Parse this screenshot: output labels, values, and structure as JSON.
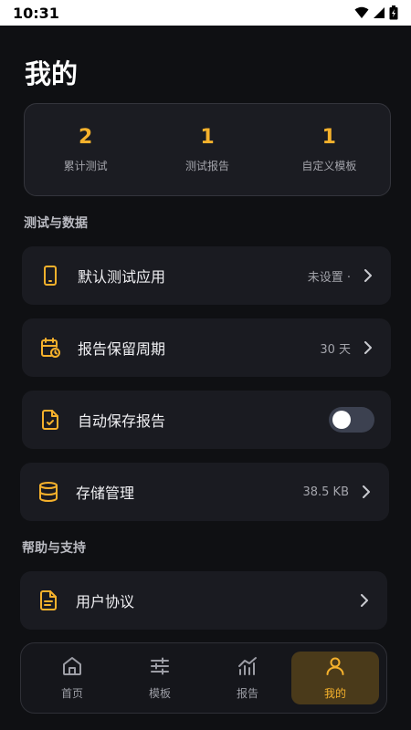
{
  "status_bar": {
    "time": "10:31"
  },
  "page": {
    "title": "我的"
  },
  "stats": [
    {
      "value": "2",
      "label": "累计测试"
    },
    {
      "value": "1",
      "label": "测试报告"
    },
    {
      "value": "1",
      "label": "自定义模板"
    }
  ],
  "sections": {
    "testing_data": "测试与数据",
    "help_support": "帮助与支持"
  },
  "rows": {
    "default_app": {
      "label": "默认测试应用",
      "value": "未设置 ·"
    },
    "retention": {
      "label": "报告保留周期",
      "value": "30 天"
    },
    "auto_save": {
      "label": "自动保存报告",
      "toggle_on": false
    },
    "storage": {
      "label": "存储管理",
      "value": "38.5 KB"
    },
    "agreement": {
      "label": "用户协议"
    }
  },
  "tabs": [
    {
      "label": "首页",
      "icon": "home-icon"
    },
    {
      "label": "模板",
      "icon": "sliders-icon"
    },
    {
      "label": "报告",
      "icon": "chart-icon"
    },
    {
      "label": "我的",
      "icon": "user-icon",
      "active": true
    }
  ],
  "colors": {
    "accent": "#f5b12c",
    "background": "#0f1013",
    "card": "#1a1b21"
  }
}
